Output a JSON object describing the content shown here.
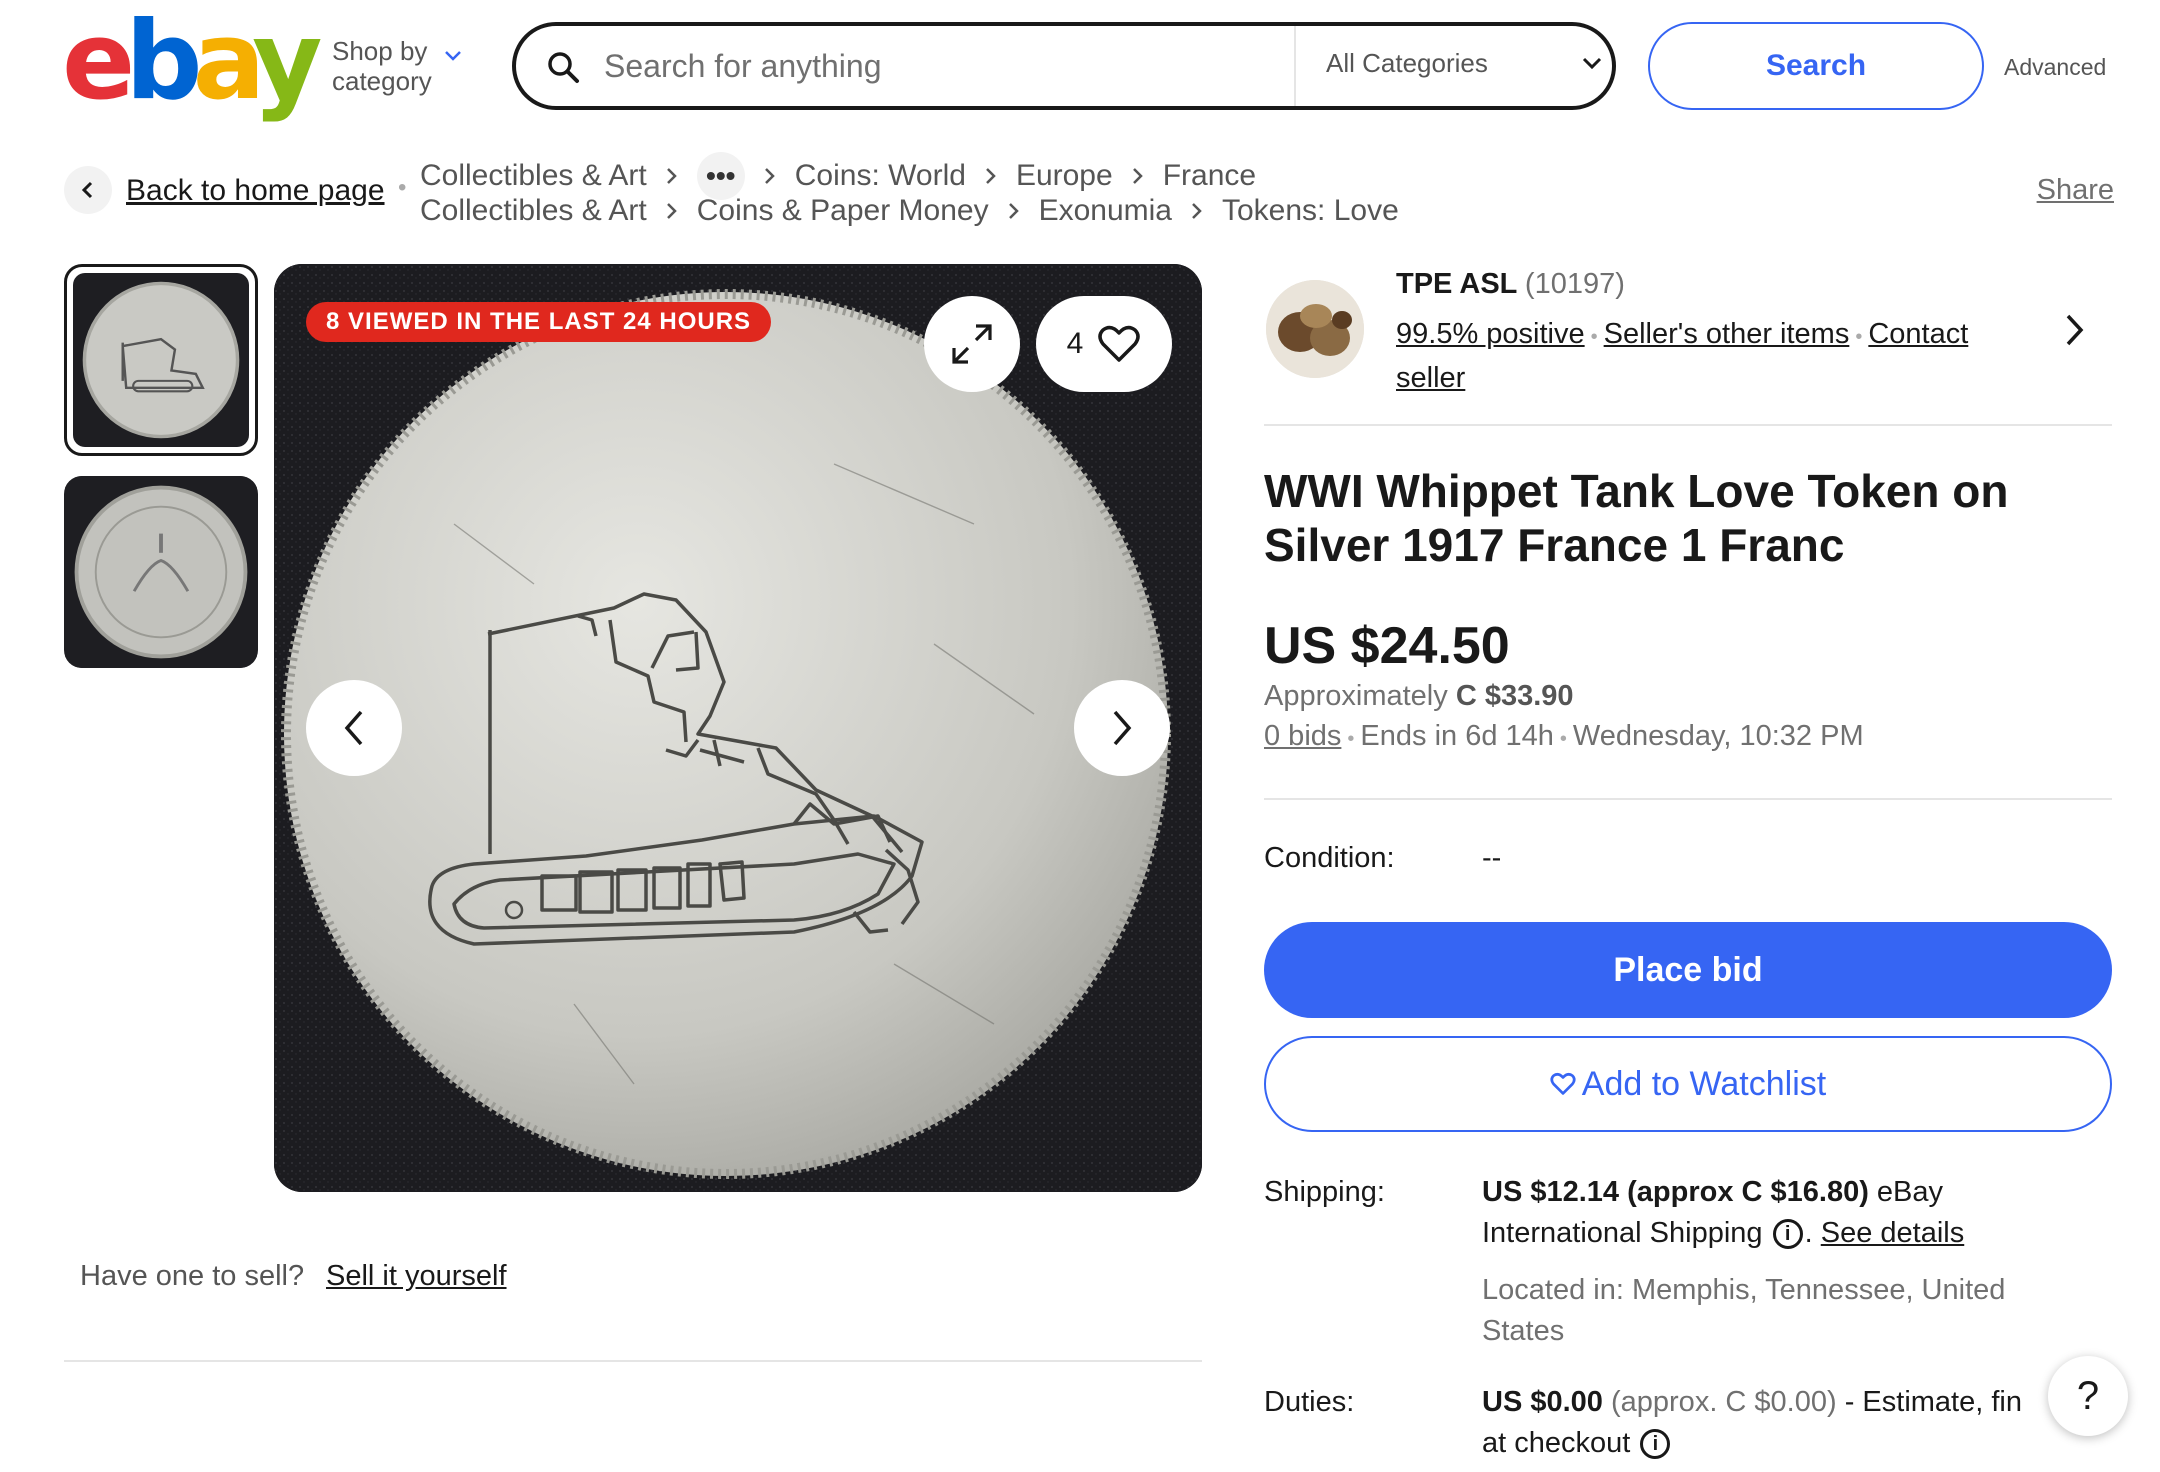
{
  "header": {
    "logo_letters": [
      "e",
      "b",
      "a",
      "y"
    ],
    "shop_by_line1": "Shop by",
    "shop_by_line2": "category",
    "search_placeholder": "Search for anything",
    "category_select": "All Categories",
    "search_button": "Search",
    "advanced_link": "Advanced"
  },
  "breadcrumb": {
    "back_label": "Back to home page",
    "row1": [
      "Collectibles & Art",
      "Coins: World",
      "Europe",
      "France"
    ],
    "row1_more": "•••",
    "row2": [
      "Collectibles & Art",
      "Coins & Paper Money",
      "Exonumia",
      "Tokens: Love"
    ],
    "share": "Share"
  },
  "gallery": {
    "badge": "8 VIEWED IN THE LAST 24 HOURS",
    "watch_count": "4",
    "thumbnail_count": 2,
    "icons": [
      "expand-icon",
      "heart-icon",
      "chevron-left-icon",
      "chevron-right-icon"
    ]
  },
  "sell": {
    "question": "Have one to sell?",
    "link": "Sell it yourself"
  },
  "seller": {
    "name": "TPE ASL",
    "feedback_count": "(10197)",
    "positive": "99.5% positive",
    "other_items": "Seller's other items",
    "contact_line1": "Contact",
    "contact_line2": "seller"
  },
  "listing": {
    "title_line1": "WWI Whippet Tank Love Token on",
    "title_line2": "Silver 1917 France 1 Franc",
    "price": "US $24.50",
    "approx_label": "Approximately",
    "approx_value": "C $33.90",
    "bids": "0 bids",
    "ends": "Ends in 6d 14h",
    "end_time": "Wednesday, 10:32 PM",
    "condition_label": "Condition:",
    "condition_value": "--",
    "place_bid": "Place bid",
    "add_watchlist": "Add to Watchlist"
  },
  "shipping": {
    "label": "Shipping:",
    "cost": "US $12.14 (approx C $16.80)",
    "service_a": "eBay",
    "service_b": "International Shipping",
    "see_details": "See details",
    "located_line1": "Located in: Memphis, Tennessee, United",
    "located_line2": "States"
  },
  "duties": {
    "label": "Duties:",
    "amount": "US $0.00",
    "approx": "(approx. C $0.00)",
    "note": "- Estimate, fin",
    "line2": "at checkout"
  },
  "help": "?",
  "colors": {
    "accent": "#3665f3",
    "badge": "#e0281e",
    "logo_e": "#e53238",
    "logo_b": "#0064d2",
    "logo_a": "#f5af02",
    "logo_y": "#86b817"
  }
}
